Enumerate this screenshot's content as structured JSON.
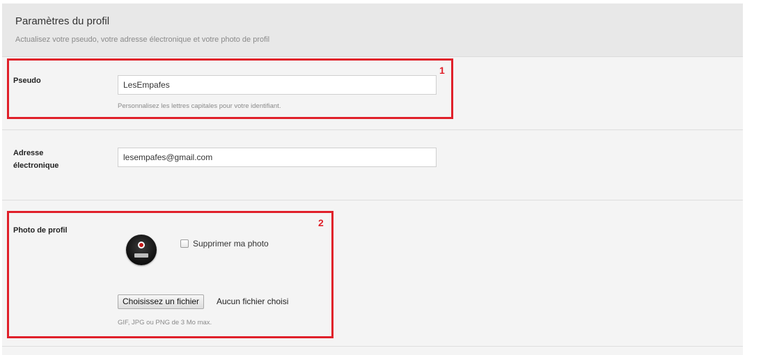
{
  "header": {
    "title": "Paramètres du profil",
    "subtitle": "Actualisez votre pseudo, votre adresse électronique et votre photo de profil"
  },
  "pseudo": {
    "label": "Pseudo",
    "value": "LesEmpafes",
    "hint": "Personnalisez les lettres capitales pour votre identifiant."
  },
  "email": {
    "label_line1": "Adresse",
    "label_line2": "électronique",
    "value": "lesempafes@gmail.com"
  },
  "photo": {
    "label": "Photo de profil",
    "delete_label": "Supprimer ma photo",
    "delete_checked": false,
    "file_button": "Choisissez un fichier",
    "file_status": "Aucun fichier choisi",
    "hint": "GIF, JPG ou PNG de 3 Mo max."
  },
  "annotations": {
    "box1": "1",
    "box2": "2",
    "color": "#e0202a"
  }
}
